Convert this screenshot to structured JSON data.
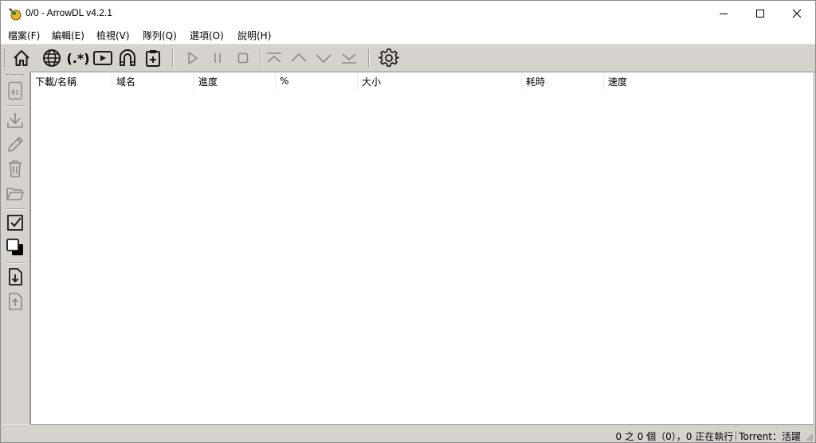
{
  "window": {
    "title": "0/0 - ArrowDL v4.2.1"
  },
  "menu": [
    {
      "label": "檔案(F)"
    },
    {
      "label": "編輯(E)"
    },
    {
      "label": "檢視(V)"
    },
    {
      "label": "隊列(Q)"
    },
    {
      "label": "選項(O)"
    },
    {
      "label": "說明(H)"
    }
  ],
  "toolbar": {
    "items": [
      {
        "icon": "home-icon"
      },
      {
        "icon": "globe-icon"
      },
      {
        "icon": "regex-icon",
        "text": "(.*)"
      },
      {
        "icon": "stream-play-icon"
      },
      {
        "icon": "magnet-icon"
      },
      {
        "icon": "clipboard-add-icon"
      },
      {
        "icon": "play-icon"
      },
      {
        "icon": "pause-icon"
      },
      {
        "icon": "stop-icon"
      },
      {
        "icon": "move-top-icon"
      },
      {
        "icon": "move-up-icon"
      },
      {
        "icon": "move-down-icon"
      },
      {
        "icon": "move-bottom-icon"
      },
      {
        "icon": "settings-gear-icon"
      }
    ]
  },
  "sidebar": {
    "items": [
      {
        "icon": "info-binary-icon",
        "text": "01"
      },
      {
        "icon": "download-icon"
      },
      {
        "icon": "edit-pencil-icon"
      },
      {
        "icon": "trash-icon"
      },
      {
        "icon": "open-folder-icon"
      },
      {
        "icon": "select-all-checkbox-icon"
      },
      {
        "icon": "invert-selection-icon"
      },
      {
        "icon": "import-file-icon"
      },
      {
        "icon": "export-file-icon"
      }
    ]
  },
  "table": {
    "columns": [
      {
        "label": "下載/名稱"
      },
      {
        "label": "域名"
      },
      {
        "label": "進度"
      },
      {
        "label": "%"
      },
      {
        "label": "大小"
      },
      {
        "label": "耗時"
      },
      {
        "label": "速度"
      }
    ],
    "rows": []
  },
  "status": {
    "count_text": "0 之 0 個（0），0 正在執行",
    "torrent_text": "Torrent：活躍"
  },
  "colors": {
    "toolbar_bg": "#d6d3ce",
    "icon_dark": "#1a1a1a",
    "icon_disabled": "#8a8a8a"
  }
}
